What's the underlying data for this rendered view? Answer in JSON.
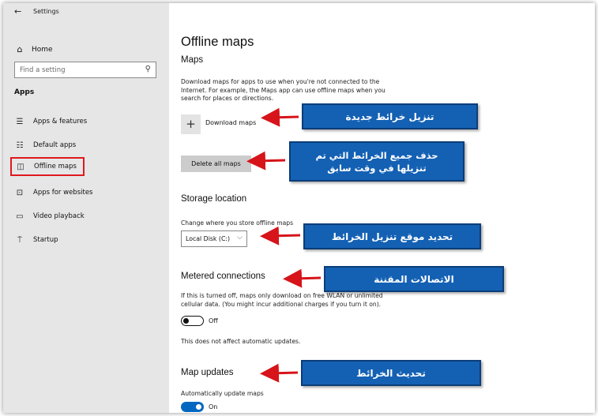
{
  "window": {
    "title": "Settings"
  },
  "sidebar": {
    "home_label": "Home",
    "search_placeholder": "Find a setting",
    "section_title": "Apps",
    "items": [
      {
        "label": "Apps & features",
        "icon": "list-icon"
      },
      {
        "label": "Default apps",
        "icon": "default-apps-icon"
      },
      {
        "label": "Offline maps",
        "icon": "map-icon",
        "selected": true
      },
      {
        "label": "Apps for websites",
        "icon": "web-apps-icon"
      },
      {
        "label": "Video playback",
        "icon": "video-icon"
      },
      {
        "label": "Startup",
        "icon": "startup-icon"
      }
    ]
  },
  "main": {
    "title": "Offline maps",
    "maps_heading": "Maps",
    "maps_description": "Download maps for apps to use when you're not connected to the Internet. For example, the Maps app can use offline maps when you search for places or directions.",
    "download_label": "Download maps",
    "delete_label": "Delete all maps",
    "storage_heading": "Storage location",
    "storage_caption": "Change where you store offline maps",
    "storage_value": "Local Disk (C:)",
    "metered_heading": "Metered connections",
    "metered_description": "If this is turned off, maps only download on free WLAN or unlimited cellular data. (You might incur additional charges if you turn it on).",
    "metered_toggle_state": "Off",
    "metered_note": "This does not affect automatic updates.",
    "updates_heading": "Map updates",
    "updates_caption": "Automatically update maps",
    "updates_toggle_state": "On"
  },
  "annotations": {
    "download": "تنزيل خرائط جديدة",
    "delete_line1": "حذف جميع الخرائط التي تم",
    "delete_line2": "تنزيلها في وقت سابق",
    "storage": "تحديد موقع تنزيل الخرائط",
    "metered": "الاتصالات المقننة",
    "updates": "تحديث الخرائط"
  },
  "colors": {
    "sidebar_bg": "#e6e6e6",
    "highlight_border": "#e0191e",
    "callout_bg": "#1461b4",
    "arrow": "#d6141a",
    "toggle_on": "#0067c0"
  }
}
